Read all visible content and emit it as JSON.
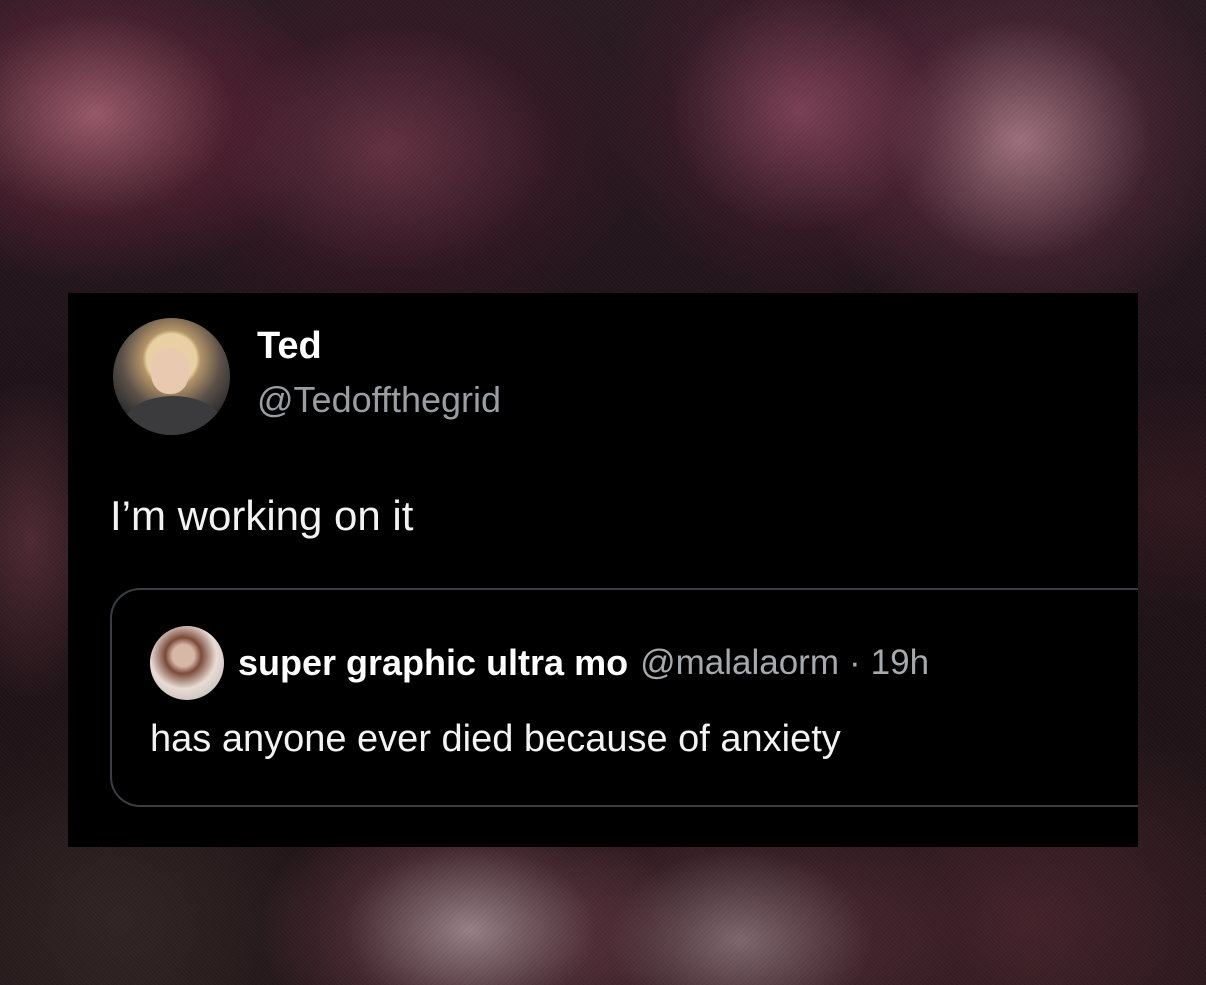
{
  "tweet": {
    "author_name": "Ted",
    "author_handle": "@Tedoffthegrid",
    "text": "I’m working on it",
    "avatar_icon": "profile-photo"
  },
  "quoted_tweet": {
    "author_name": "super graphic ultra mo",
    "author_handle": "@malalaorm",
    "separator": "·",
    "time": "19h",
    "text": "has anyone ever died because of anxiety",
    "avatar_icon": "profile-photo"
  },
  "colors": {
    "card_background": "#000000",
    "primary_text": "#e7e9ea",
    "secondary_text": "#9a9ea3",
    "quote_border": "#3a3d41"
  }
}
